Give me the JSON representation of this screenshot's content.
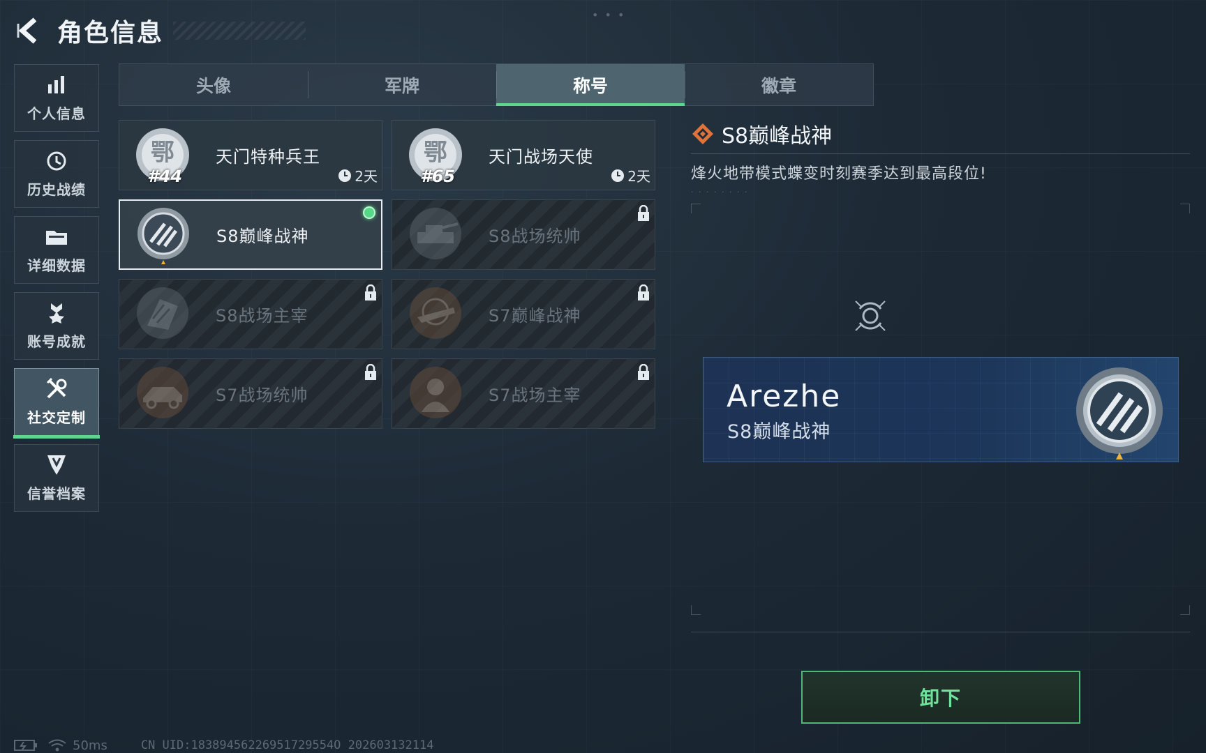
{
  "header": {
    "title": "角色信息"
  },
  "sidebar": {
    "items": [
      {
        "label": "个人信息",
        "icon": "bar-chart-icon",
        "active": false
      },
      {
        "label": "历史战绩",
        "icon": "history-icon",
        "active": false
      },
      {
        "label": "详细数据",
        "icon": "folder-icon",
        "active": false
      },
      {
        "label": "账号成就",
        "icon": "achievement-icon",
        "active": false
      },
      {
        "label": "社交定制",
        "icon": "tools-icon",
        "active": true
      },
      {
        "label": "信誉档案",
        "icon": "shield-icon",
        "active": false
      }
    ]
  },
  "tabs": [
    {
      "label": "头像",
      "active": false
    },
    {
      "label": "军牌",
      "active": false
    },
    {
      "label": "称号",
      "active": true
    },
    {
      "label": "徽章",
      "active": false
    }
  ],
  "titles": [
    {
      "name": "天门特种兵王",
      "rank": "#44",
      "timer": "2天",
      "locked": false
    },
    {
      "name": "天门战场天使",
      "rank": "#65",
      "timer": "2天",
      "locked": false
    },
    {
      "name": "S8巅峰战神",
      "locked": false,
      "equipped": true
    },
    {
      "name": "S8战场统帅",
      "locked": true
    },
    {
      "name": "S8战场主宰",
      "locked": true
    },
    {
      "name": "S7巅峰战神",
      "locked": true
    },
    {
      "name": "S7战场统帅",
      "locked": true
    },
    {
      "name": "S7战场主宰",
      "locked": true
    }
  ],
  "detail": {
    "title": "S8巅峰战神",
    "description": "烽火地带模式蝶变时刻赛季达到最高段位!",
    "sub": "· · · ·   · · · ·"
  },
  "nameplate": {
    "player": "Arezhe",
    "title": "S8巅峰战神"
  },
  "actions": {
    "unequip": "卸下"
  },
  "status": {
    "ping": "50ms",
    "uid": "CN UID:18389456226951729554O 202603132114"
  },
  "colors": {
    "accent": "#5fd68f",
    "diamond": "#e0733a",
    "plate": "#1d3254"
  }
}
